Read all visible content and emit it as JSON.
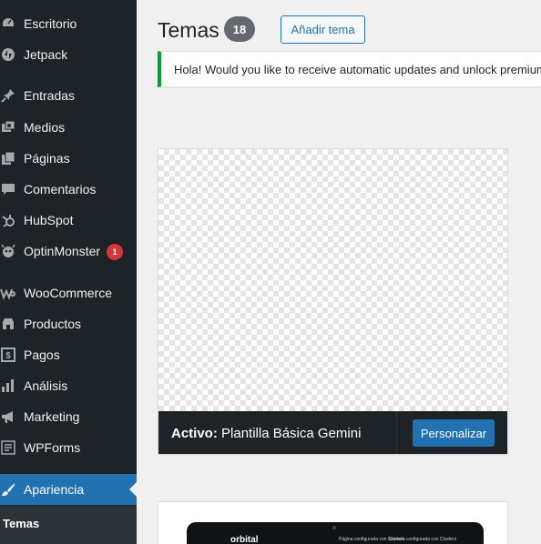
{
  "sidebar": {
    "items": [
      {
        "label": "Escritorio",
        "icon": "dashboard-icon"
      },
      {
        "label": "Jetpack",
        "icon": "jetpack-icon"
      },
      {
        "label": "Entradas",
        "icon": "pin-icon"
      },
      {
        "label": "Medios",
        "icon": "media-icon"
      },
      {
        "label": "Páginas",
        "icon": "pages-icon"
      },
      {
        "label": "Comentarios",
        "icon": "comment-icon"
      },
      {
        "label": "HubSpot",
        "icon": "hubspot-icon"
      },
      {
        "label": "OptinMonster",
        "icon": "optinmonster-icon",
        "badge": "1"
      },
      {
        "label": "WooCommerce",
        "icon": "woocommerce-icon"
      },
      {
        "label": "Productos",
        "icon": "products-icon"
      },
      {
        "label": "Pagos",
        "icon": "payments-icon"
      },
      {
        "label": "Análisis",
        "icon": "analytics-icon"
      },
      {
        "label": "Marketing",
        "icon": "megaphone-icon"
      },
      {
        "label": "WPForms",
        "icon": "wpforms-icon"
      },
      {
        "label": "Apariencia",
        "icon": "brush-icon",
        "active": true
      }
    ],
    "submenu": {
      "label": "Temas"
    }
  },
  "header": {
    "title": "Temas",
    "count": "18",
    "add_button": "Añadir tema"
  },
  "notice": {
    "text": "Hola! Would you like to receive automatic updates and unlock premium"
  },
  "active_theme": {
    "prefix": "Activo:",
    "name": "Plantilla Básica Gemini",
    "customize_button": "Personalizar"
  },
  "second_theme": {
    "logo": "orbital",
    "nav_1": "Página configurada con Clusters",
    "nav_2": "Entrada configurada con Clusters"
  },
  "colors": {
    "sidebar_bg": "#1d2327",
    "accent": "#2271b1",
    "notice_border": "#00a32a",
    "badge": "#d63638"
  }
}
